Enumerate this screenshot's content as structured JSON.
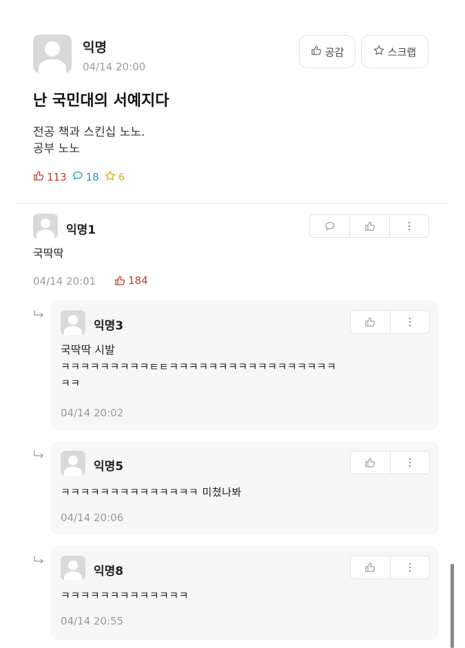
{
  "post": {
    "author": "익명",
    "time": "04/14 20:00",
    "like_button": "공감",
    "scrap_button": "스크랩",
    "title": "난 국민대의 서예지다",
    "body_line1": "전공 책과 스킨십 노노.",
    "body_line2": "공부 노노",
    "likes": "113",
    "comments": "18",
    "scraps": "6"
  },
  "comments": [
    {
      "author": "익명1",
      "text": "국딱딱",
      "time": "04/14 20:01",
      "likes": "184"
    }
  ],
  "replies": [
    {
      "author": "익명3",
      "text_line1": "국딱딱 시발",
      "text_line2": "ㅋㅋㅋㅋㅋㅋㅋㅋㅋㅌㅌㅋㅋㅋㅋㅋㅋㅋㅋㅋㅋㅋㅋㅋㅋㅋㅋㅋ",
      "text_line3": "ㅋㅋ",
      "time": "04/14 20:02"
    },
    {
      "author": "익명5",
      "text_line1": "ㅋㅋㅋㅋㅋㅋㅋㅋㅋㅋㅋㅋㅋㅋ 미쳤나봐",
      "time": "04/14 20:06"
    },
    {
      "author": "익명8",
      "text_line1": "ㅋㅋㅋㅋㅋㅋㅋㅋㅋㅋㅋㅋㅋ",
      "time": "04/14 20:55"
    }
  ],
  "icons": {
    "like": "thumbs-up-icon",
    "comment": "speech-bubble-icon",
    "scrap": "star-icon",
    "more": "vertical-dots-icon",
    "reply": "reply-arrow-icon"
  },
  "colors": {
    "like": "#c0392b",
    "comment": "#1f9bbd",
    "scrap": "#d5ad19"
  }
}
